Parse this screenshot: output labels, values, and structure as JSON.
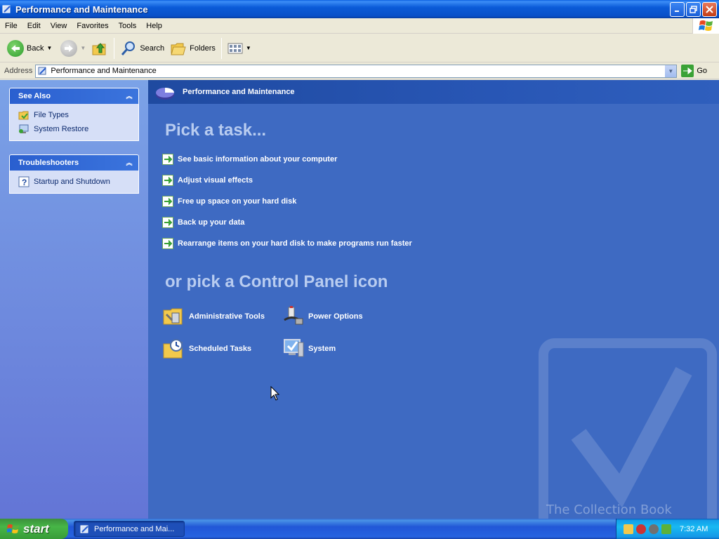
{
  "window": {
    "title": "Performance and Maintenance"
  },
  "menu": [
    "File",
    "Edit",
    "View",
    "Favorites",
    "Tools",
    "Help"
  ],
  "toolbar": {
    "back": "Back",
    "search": "Search",
    "folders": "Folders"
  },
  "address": {
    "label": "Address",
    "value": "Performance and Maintenance",
    "go": "Go"
  },
  "sidebar": {
    "see_also": {
      "title": "See Also",
      "items": [
        "File Types",
        "System Restore"
      ]
    },
    "troubleshooters": {
      "title": "Troubleshooters",
      "items": [
        "Startup and Shutdown"
      ]
    }
  },
  "main": {
    "header": "Performance and Maintenance",
    "pick_task": "Pick a task...",
    "tasks": [
      "See basic information about your computer",
      "Adjust visual effects",
      "Free up space on your hard disk",
      "Back up your data",
      "Rearrange items on your hard disk to make programs run faster"
    ],
    "pick_icon": "or pick a Control Panel icon",
    "icons": [
      "Administrative Tools",
      "Power Options",
      "Scheduled Tasks",
      "System"
    ]
  },
  "taskbar": {
    "start": "start",
    "task_item": "Performance and Mai...",
    "clock": "7:32 AM",
    "watermark": "The Collection Book"
  }
}
